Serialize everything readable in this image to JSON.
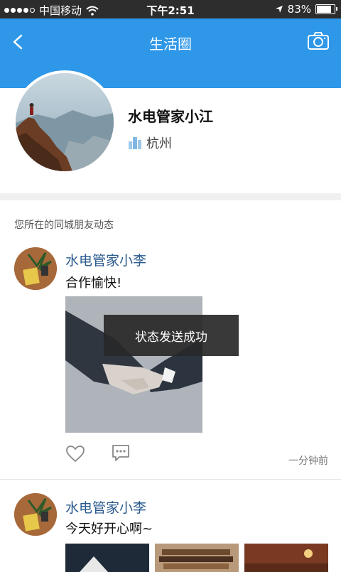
{
  "status_bar": {
    "carrier": "中国移动",
    "time": "下午2:51",
    "battery": "83%",
    "battery_level": 0.83
  },
  "nav": {
    "title": "生活圈",
    "back_icon": "chevron-left-icon",
    "camera_icon": "camera-icon"
  },
  "profile": {
    "name": "水电管家小江",
    "location": "杭州",
    "location_icon": "city-building-icon"
  },
  "feed": {
    "section_title": "您所在的同城朋友动态",
    "posts": [
      {
        "author": "水电管家小李",
        "text": "合作愉快!",
        "time": "一分钟前"
      },
      {
        "author": "水电管家小李",
        "text": "今天好开心啊~"
      }
    ]
  },
  "toast": {
    "message": "状态发送成功"
  },
  "colors": {
    "primary": "#2f97e8",
    "author_name": "#2a5a8e",
    "status_bar_bg": "#2d2d2d"
  }
}
